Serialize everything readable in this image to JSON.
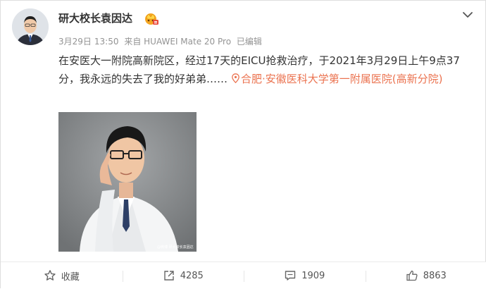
{
  "user": {
    "name": "研大校长袁因达",
    "avatar_icon": "avatar",
    "badge_icon": "vip-crown-icon"
  },
  "meta": {
    "date": "3月29日",
    "time": "13:50",
    "source": "来自 HUAWEI Mate 20 Pro",
    "edited": "已编辑"
  },
  "post": {
    "text": "在安医大一附院高新院区，经过17天的EICU抢救治疗，于2021年3月29日上午9点37分，我永远的失去了我的好弟弟……",
    "location": "合肥·安徽医科大学第一附属医院(高新分院)",
    "image_watermark": "@微博 研大校长袁因达"
  },
  "actions": [
    {
      "name": "collect",
      "label": "收藏",
      "icon": "star-icon"
    },
    {
      "name": "repost",
      "label": "4285",
      "icon": "share-icon"
    },
    {
      "name": "comment",
      "label": "1909",
      "icon": "comment-icon"
    },
    {
      "name": "like",
      "label": "8863",
      "icon": "thumbs-up-icon"
    }
  ],
  "colors": {
    "location": "#eb7350",
    "meta": "#939393",
    "text": "#333333"
  }
}
